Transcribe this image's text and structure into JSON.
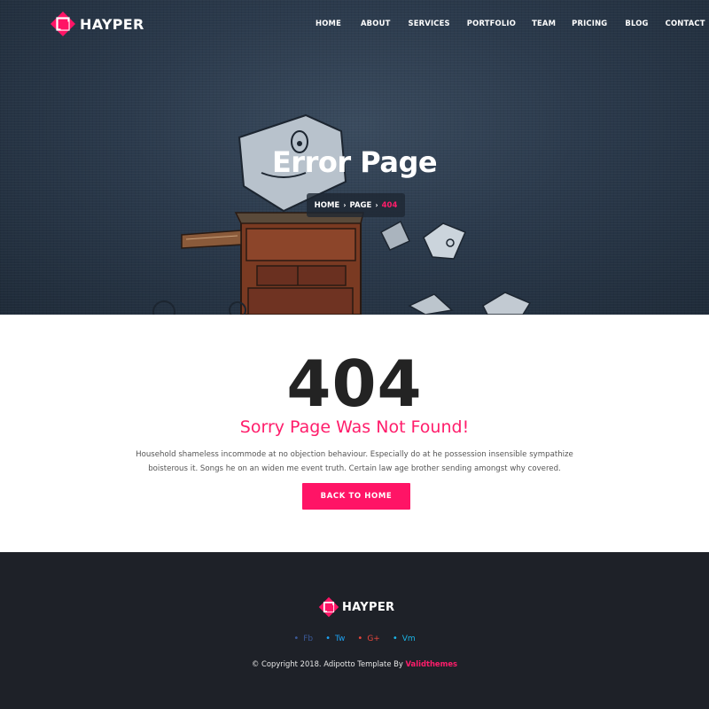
{
  "brand": {
    "name": "HAYPER",
    "color": "#ff1466"
  },
  "nav": {
    "items": [
      {
        "label": "HOME"
      },
      {
        "label": "ABOUT"
      },
      {
        "label": "SERVICES"
      },
      {
        "label": "PORTFOLIO"
      },
      {
        "label": "TEAM"
      },
      {
        "label": "PRICING"
      },
      {
        "label": "BLOG"
      },
      {
        "label": "CONTACT"
      }
    ]
  },
  "hero": {
    "title": "Error Page",
    "breadcrumb": {
      "home": "HOME",
      "page": "PAGE",
      "current": "404",
      "separator_icon": "chevron-right-icon"
    }
  },
  "main": {
    "code": "404",
    "heading": "Sorry Page Was Not Found!",
    "description": "Household shameless incommode at no objection behaviour. Especially do at he possession insensible sympathize boisterous it. Songs he on an widen me event truth. Certain law age brother sending amongst why covered.",
    "button_label": "BACK TO HOME"
  },
  "footer": {
    "brand": "HAYPER",
    "social": [
      {
        "label": "Fb",
        "color": "#3b5998"
      },
      {
        "label": "Tw",
        "color": "#1da1f2"
      },
      {
        "label": "G+",
        "color": "#e8453c"
      },
      {
        "label": "Vm",
        "color": "#1ab7ea"
      }
    ],
    "copyright_prefix": "© Copyright 2018. Adipotto Template By ",
    "copyright_link": "Validthemes"
  },
  "colors": {
    "accent": "#ff1466",
    "dark": "#1e2128",
    "hero_bg": "#2b3a4c"
  }
}
